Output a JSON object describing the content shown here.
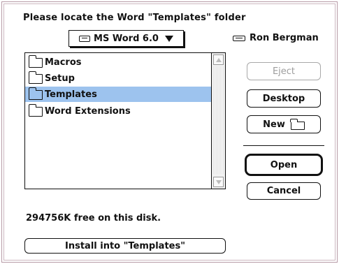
{
  "dialog": {
    "prompt": "Please locate the Word \"Templates\" folder",
    "volume_popup": {
      "label": "MS Word 6.0",
      "icon": "disk-icon"
    },
    "user_label": "Ron Bergman",
    "file_list": {
      "items": [
        {
          "label": "Macros",
          "icon": "folder-icon",
          "selected": false
        },
        {
          "label": "Setup",
          "icon": "folder-icon",
          "selected": false
        },
        {
          "label": "Templates",
          "icon": "folder-icon",
          "selected": true
        },
        {
          "label": "Word Extensions",
          "icon": "folder-icon",
          "selected": false
        }
      ],
      "selection_color": "#9dc3ee"
    },
    "buttons": {
      "eject": "Eject",
      "desktop": "Desktop",
      "new": "New",
      "open": "Open",
      "cancel": "Cancel",
      "install": "Install into \"Templates\""
    },
    "free_space": "294756K free on this disk."
  }
}
